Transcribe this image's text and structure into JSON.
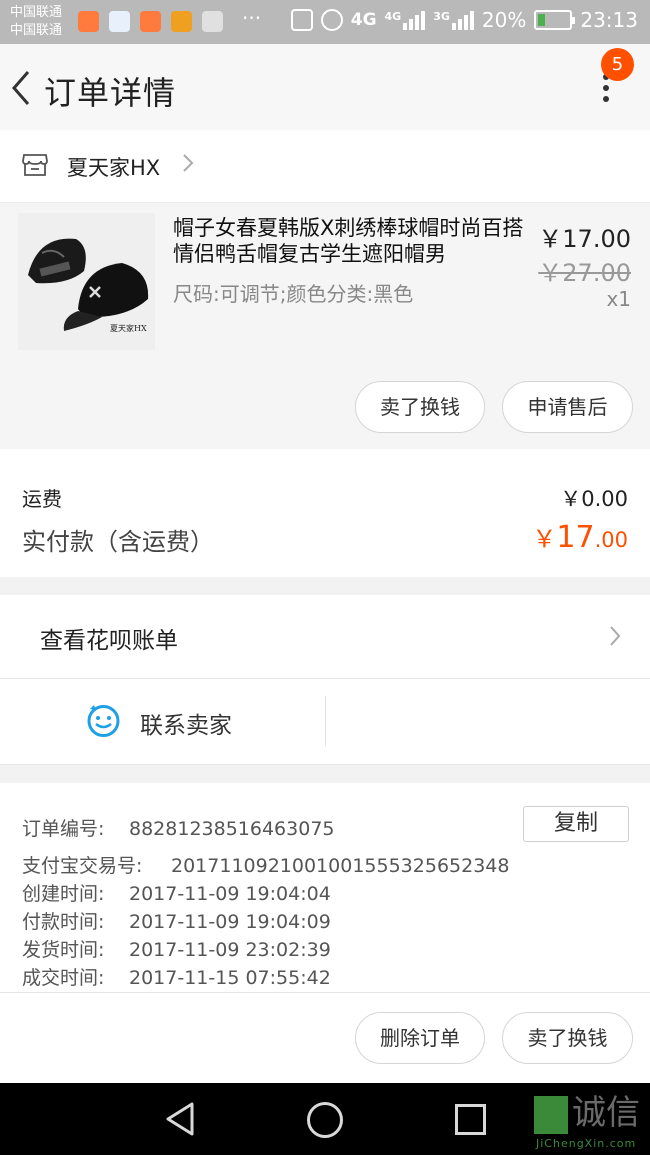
{
  "status_bar": {
    "carrier_1": "中国联通",
    "carrier_2": "中国联通",
    "more": "···",
    "net_1": "4G",
    "net_2": "4G",
    "net_3": "3G",
    "battery": "20%",
    "battery_level": 0.2,
    "time": "23:13"
  },
  "header": {
    "title": "订单详情",
    "badge": "5"
  },
  "shop": {
    "name": "夏天家HX"
  },
  "product": {
    "title": "帽子女春夏韩版X刺绣棒球帽时尚百搭情侣鸭舌帽复古学生遮阳帽男",
    "sku": "尺码:可调节;颜色分类:黑色",
    "price": "￥17.00",
    "original_price": "￥27.00",
    "quantity": "x1",
    "image_brand_text": "夏天家HX",
    "actions": {
      "sell": "卖了换钱",
      "after_sale": "申请售后"
    }
  },
  "fees": {
    "shipping_label": "运费",
    "shipping_value": "￥0.00",
    "paid_label": "实付款（含运费）",
    "paid_symbol": "￥",
    "paid_int": "17",
    "paid_dec": ".00"
  },
  "huabei": {
    "label": "查看花呗账单"
  },
  "contact": {
    "label": "联系卖家"
  },
  "order_info": {
    "order_no_label": "订单编号:",
    "order_no": "88281238516463075",
    "copy_label": "复制",
    "alipay_label": "支付宝交易号:",
    "alipay_no": "2017110921001001555325652348",
    "created_label": "创建时间:",
    "created": "2017-11-09 19:04:04",
    "paid_label": "付款时间:",
    "paid": "2017-11-09 19:04:09",
    "shipped_label": "发货时间:",
    "shipped": "2017-11-09 23:02:39",
    "completed_label": "成交时间:",
    "completed": "2017-11-15 07:55:42"
  },
  "footer": {
    "delete": "删除订单",
    "sell": "卖了换钱"
  },
  "watermark": {
    "text": "诚信",
    "sub": "JiChengXin.com"
  },
  "colors": {
    "accent": "#ff5000",
    "status_bar": "#b9b9b9",
    "nav_bar": "#000000",
    "contact_icon": "#1ea0e6"
  }
}
